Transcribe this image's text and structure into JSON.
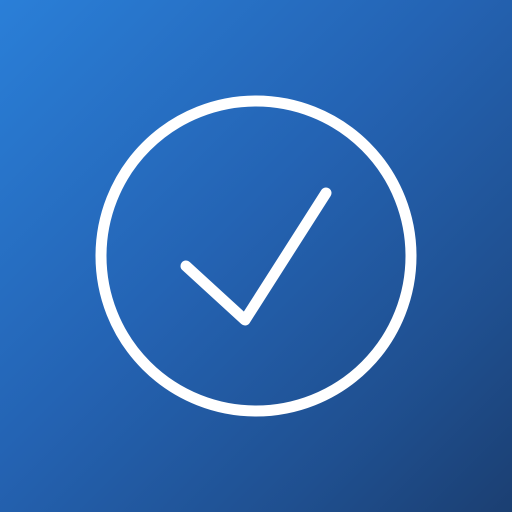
{
  "app_icon": {
    "icon": "check-circle-icon",
    "colors": {
      "gradient_start": "#2a7fd8",
      "gradient_mid": "#2463b3",
      "gradient_end": "#1b3f72",
      "glyph": "#ffffff"
    }
  }
}
